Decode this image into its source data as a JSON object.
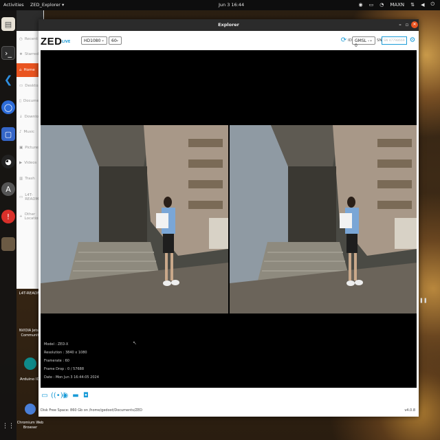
{
  "topbar": {
    "activities": "Activities",
    "app_menu": "ZED_Explorer ▾",
    "clock": "Jun 3  16:44",
    "tray_user": "MAXN"
  },
  "dock": {
    "items": [
      {
        "icon": "files-icon"
      },
      {
        "icon": "terminal-icon"
      },
      {
        "icon": "vscode-icon"
      },
      {
        "icon": "chromium-icon"
      },
      {
        "icon": "screenshot-icon"
      },
      {
        "icon": "obs-icon"
      },
      {
        "icon": "a-app-icon"
      },
      {
        "icon": "help-icon"
      },
      {
        "icon": "trash-thumb-icon"
      }
    ]
  },
  "files": {
    "items": [
      {
        "label": "Recent",
        "icon": "clock-icon"
      },
      {
        "label": "Starred",
        "icon": "star-icon"
      },
      {
        "label": "Home",
        "icon": "home-icon",
        "active": true
      },
      {
        "label": "Desktop",
        "icon": "desktop-icon"
      },
      {
        "label": "Documents",
        "icon": "document-icon"
      },
      {
        "label": "Downloads",
        "icon": "download-icon"
      },
      {
        "label": "Music",
        "icon": "music-icon"
      },
      {
        "label": "Pictures",
        "icon": "picture-icon"
      },
      {
        "label": "Videos",
        "icon": "video-icon"
      },
      {
        "label": "Trash",
        "icon": "trash-icon"
      },
      {
        "label": "L4T-README",
        "icon": "drive-icon"
      },
      {
        "label": "Other Locations",
        "icon": "plus-icon"
      }
    ]
  },
  "desktop_icons": {
    "readme": "L4T-README",
    "nvidia": "NVIDIA Jetson Community",
    "arduino": "Arduino IDE",
    "chromium": "Chromium Web Browser"
  },
  "window": {
    "title": "Explorer",
    "logo": "ZED",
    "logo_sub": "LIVE",
    "resolution": "HD1080",
    "fps": "60",
    "id_label": "ID",
    "camera_id": "GMSL - 0",
    "sn_label": "SN",
    "sn_placeholder": "SN 47798669"
  },
  "camera_info": {
    "model": "Model : ZED-X",
    "resolution": "Resolution : 3840 x 1080",
    "framerate": "Framerate : 60",
    "frame_drop": "Frame Drop : 0 / 57688",
    "date": "Date : Mon Jun 3 16:44:05 2024"
  },
  "status": {
    "disk": "Disk Free Space: 860 Gb  on  /home/gedoot/Documents/ZED",
    "version": "v4.0.8"
  },
  "colors": {
    "accent": "#1a9bd7",
    "ubuntu_orange": "#e95420"
  }
}
